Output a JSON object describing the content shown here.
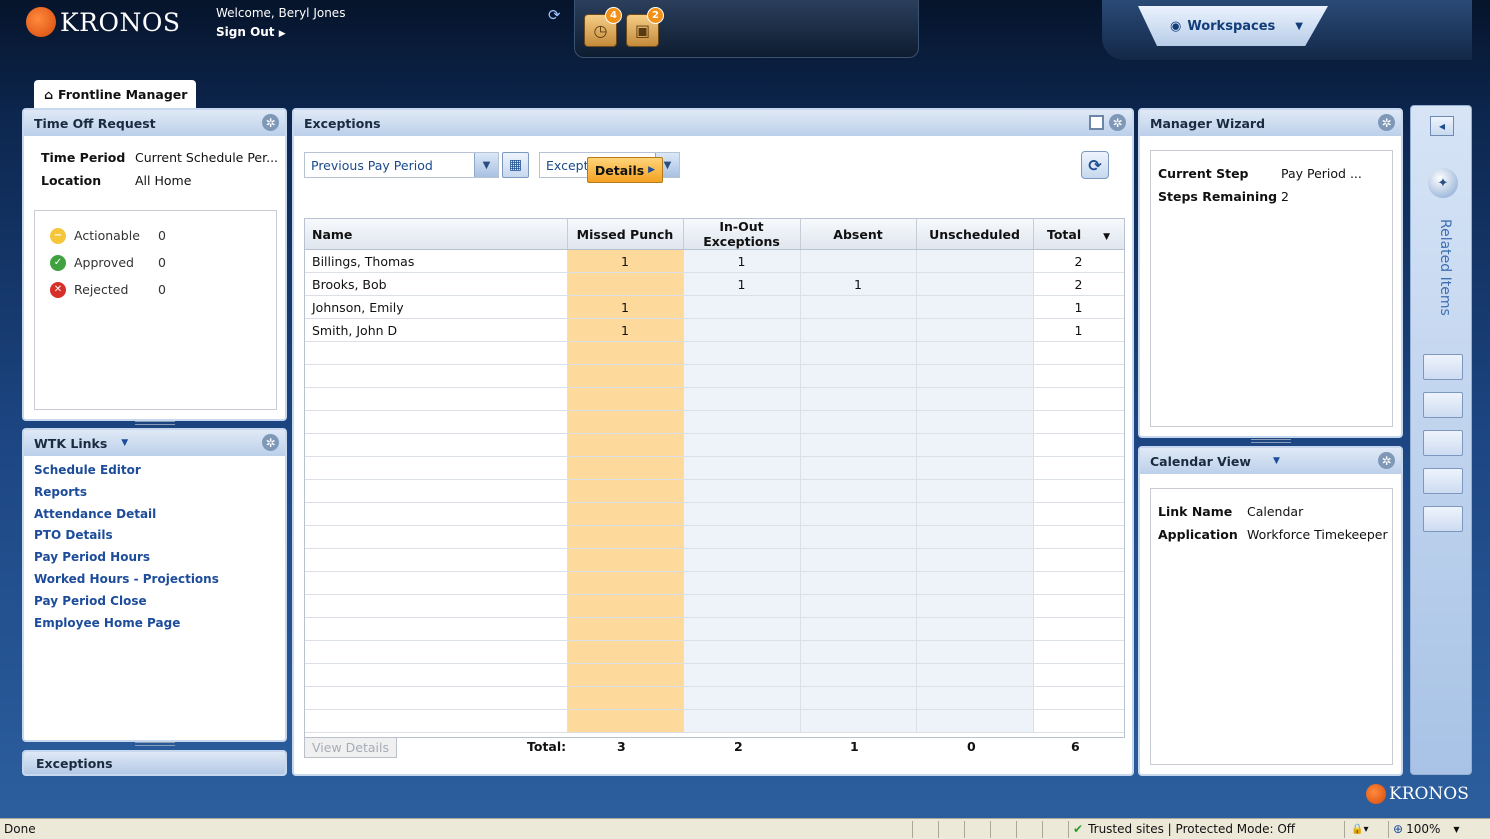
{
  "header": {
    "logo_text": "KRONOS",
    "welcome": "Welcome, Beryl Jones",
    "sign_out": "Sign Out",
    "tray": [
      {
        "icon": "clock-clipboard-icon",
        "badge": "4"
      },
      {
        "icon": "package-icon",
        "badge": "2"
      }
    ],
    "workspaces_label": "Workspaces"
  },
  "workspace_tab": {
    "label": "Frontline Manager"
  },
  "time_off_request": {
    "title": "Time Off Request",
    "time_period_label": "Time Period",
    "time_period_value": "Current Schedule Per...",
    "location_label": "Location",
    "location_value": "All Home",
    "stats": [
      {
        "label": "Actionable",
        "count": "0",
        "color": "#f5c53a"
      },
      {
        "label": "Approved",
        "count": "0",
        "color": "#3fa13f"
      },
      {
        "label": "Rejected",
        "count": "0",
        "color": "#d7302a"
      }
    ]
  },
  "wtk_links": {
    "title": "WTK Links",
    "links": [
      "Schedule Editor",
      "Reports",
      "Attendance Detail",
      "PTO Details",
      "Pay Period Hours",
      "Worked Hours - Projections",
      "Pay Period Close",
      "Employee Home Page"
    ]
  },
  "collapsed_exceptions": {
    "label": "Exceptions"
  },
  "exceptions": {
    "title": "Exceptions",
    "period_select": "Previous Pay Period",
    "type_select": "Exceptions",
    "details_button": "Details",
    "columns": [
      "Name",
      "Missed Punch",
      "In-Out Exceptions",
      "Absent",
      "Unscheduled",
      "Total"
    ],
    "rows": [
      [
        "Billings, Thomas",
        "1",
        "1",
        "",
        "",
        "2"
      ],
      [
        "Brooks, Bob",
        "",
        "1",
        "1",
        "",
        "2"
      ],
      [
        "Johnson, Emily",
        "1",
        "",
        "",
        "",
        "1"
      ],
      [
        "Smith, John D",
        "1",
        "",
        "",
        "",
        "1"
      ]
    ],
    "view_details": "View Details",
    "total_label": "Total:",
    "totals": [
      "3",
      "2",
      "1",
      "0",
      "6"
    ]
  },
  "manager_wizard": {
    "title": "Manager Wizard",
    "current_step_label": "Current Step",
    "current_step_value": "Pay Period ...",
    "steps_remaining_label": "Steps Remaining",
    "steps_remaining_value": "2"
  },
  "calendar_view": {
    "title": "Calendar View",
    "link_name_label": "Link Name",
    "link_name_value": "Calendar",
    "application_label": "Application",
    "application_value": "Workforce Timekeeper"
  },
  "related_items": {
    "label": "Related Items"
  },
  "footer_logo": "KRONOS",
  "statusbar": {
    "left": "Done",
    "zone": "Trusted sites | Protected Mode: Off",
    "zoom": "100%"
  }
}
